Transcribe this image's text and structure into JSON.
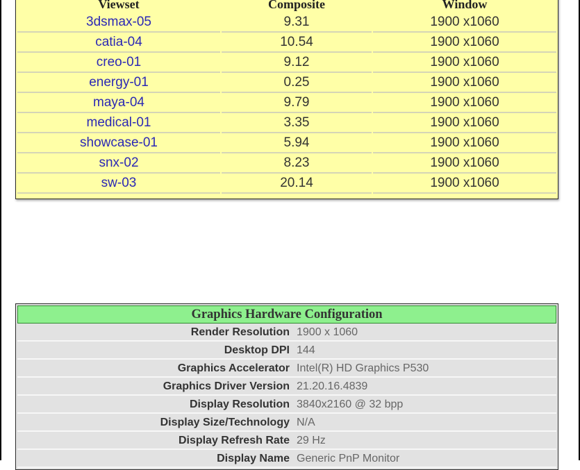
{
  "results": {
    "headers": [
      "Viewset",
      "Composite",
      "Window"
    ],
    "rows": [
      {
        "viewset": "3dsmax-05",
        "composite": "9.31",
        "window": "1900 x1060"
      },
      {
        "viewset": "catia-04",
        "composite": "10.54",
        "window": "1900 x1060"
      },
      {
        "viewset": "creo-01",
        "composite": "9.12",
        "window": "1900 x1060"
      },
      {
        "viewset": "energy-01",
        "composite": "0.25",
        "window": "1900 x1060"
      },
      {
        "viewset": "maya-04",
        "composite": "9.79",
        "window": "1900 x1060"
      },
      {
        "viewset": "medical-01",
        "composite": "3.35",
        "window": "1900 x1060"
      },
      {
        "viewset": "showcase-01",
        "composite": "5.94",
        "window": "1900 x1060"
      },
      {
        "viewset": "snx-02",
        "composite": "8.23",
        "window": "1900 x1060"
      },
      {
        "viewset": "sw-03",
        "composite": "20.14",
        "window": "1900 x1060"
      }
    ]
  },
  "hardware": {
    "title": "Graphics Hardware Configuration",
    "rows": [
      {
        "label": "Render Resolution",
        "value": "1900 x 1060"
      },
      {
        "label": "Desktop DPI",
        "value": "144"
      },
      {
        "label": "Graphics Accelerator",
        "value": "Intel(R) HD Graphics P530"
      },
      {
        "label": "Graphics Driver Version",
        "value": "21.20.16.4839"
      },
      {
        "label": "Display Resolution",
        "value": "3840x2160 @ 32 bpp"
      },
      {
        "label": "Display Size/Technology",
        "value": "N/A"
      },
      {
        "label": "Display Refresh Rate",
        "value": "29 Hz"
      },
      {
        "label": "Display Name",
        "value": "Generic PnP Monitor"
      }
    ]
  },
  "colors": {
    "results_bg": "#ffffa7",
    "viewset_link": "#2b28b5",
    "hw_header_bg": "#8ef08e",
    "hw_bg": "#e2e2e2"
  }
}
